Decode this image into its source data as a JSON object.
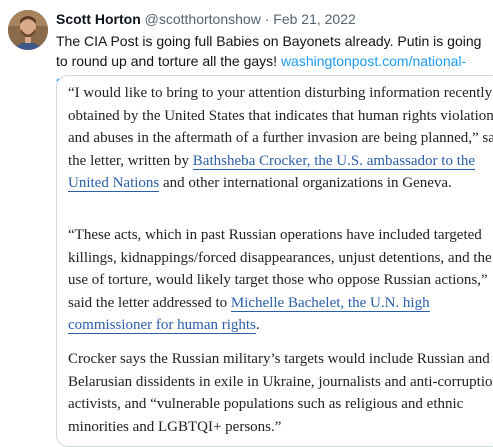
{
  "tweet": {
    "author_name": "Scott Horton",
    "author_handle": "@scotthortonshow",
    "separator": "·",
    "date": "Feb 21, 2022",
    "text": "The CIA Post is going full Babies on Bayonets already. Putin is going to round up and torture all the gays!",
    "link_text": "washingtonpost.com/national-secur…"
  },
  "quote": {
    "p1_a": "“I would like to bring to your attention disturbing information recently obtained by the United States that indicates that human rights violations and abuses in the aftermath of a further invasion are being planned,” said the letter, written by ",
    "p1_link": "Bathsheba Crocker, the U.S. ambassador to the United Nations",
    "p1_b": " and other international organizations in Geneva.",
    "p2_a": "“These acts, which in past Russian operations have included targeted killings, kidnappings/forced disappearances, unjust detentions, and the use of torture, would likely target those who oppose Russian actions,” said the letter addressed to ",
    "p2_link": "Michelle Bachelet, the U.N. high commissioner for human rights",
    "p2_b": ".",
    "p3": "Crocker says the Russian military’s targets would include Russian and Belarusian dissidents in exile in Ukraine, journalists and anti-corruption activists, and “vulnerable populations such as religious and ethnic minorities and LGBTQI+ persons.”"
  }
}
